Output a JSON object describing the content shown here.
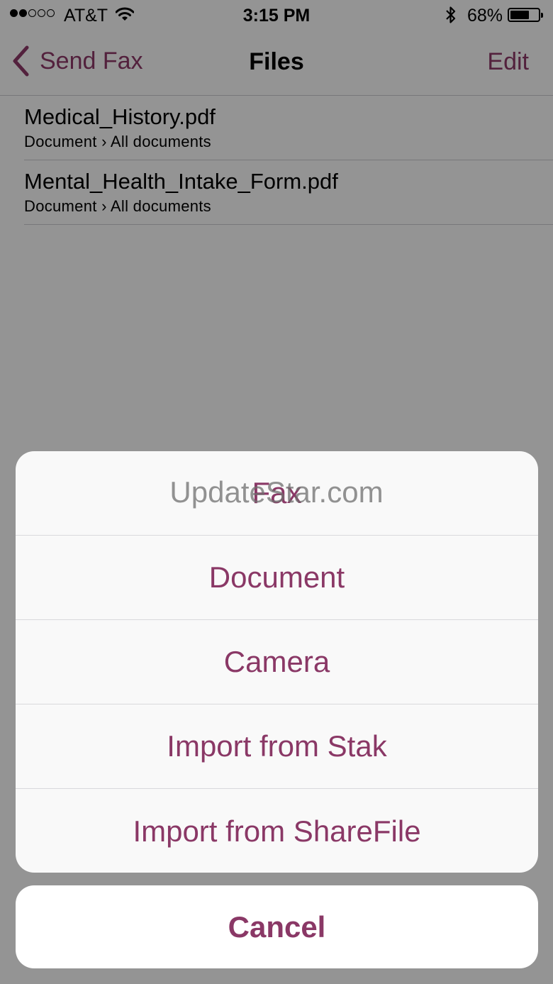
{
  "status_bar": {
    "carrier": "AT&T",
    "time": "3:15 PM",
    "battery_percent": "68%",
    "signal_bars": 2,
    "signal_max": 5,
    "battery_level": 0.68
  },
  "nav": {
    "back_label": "Send Fax",
    "title": "Files",
    "edit_label": "Edit"
  },
  "files": [
    {
      "name": "Medical_History.pdf",
      "path": "Document › All documents"
    },
    {
      "name": "Mental_Health_Intake_Form.pdf",
      "path": "Document › All documents"
    }
  ],
  "action_sheet": {
    "items": [
      {
        "label": "Fax"
      },
      {
        "label": "Document"
      },
      {
        "label": "Camera"
      },
      {
        "label": "Import from Stak"
      },
      {
        "label": "Import from ShareFile"
      }
    ],
    "cancel_label": "Cancel"
  },
  "watermark": "UpdateStar.com",
  "colors": {
    "accent": "#8a3866",
    "overlay": "rgba(0,0,0,0.4)"
  }
}
